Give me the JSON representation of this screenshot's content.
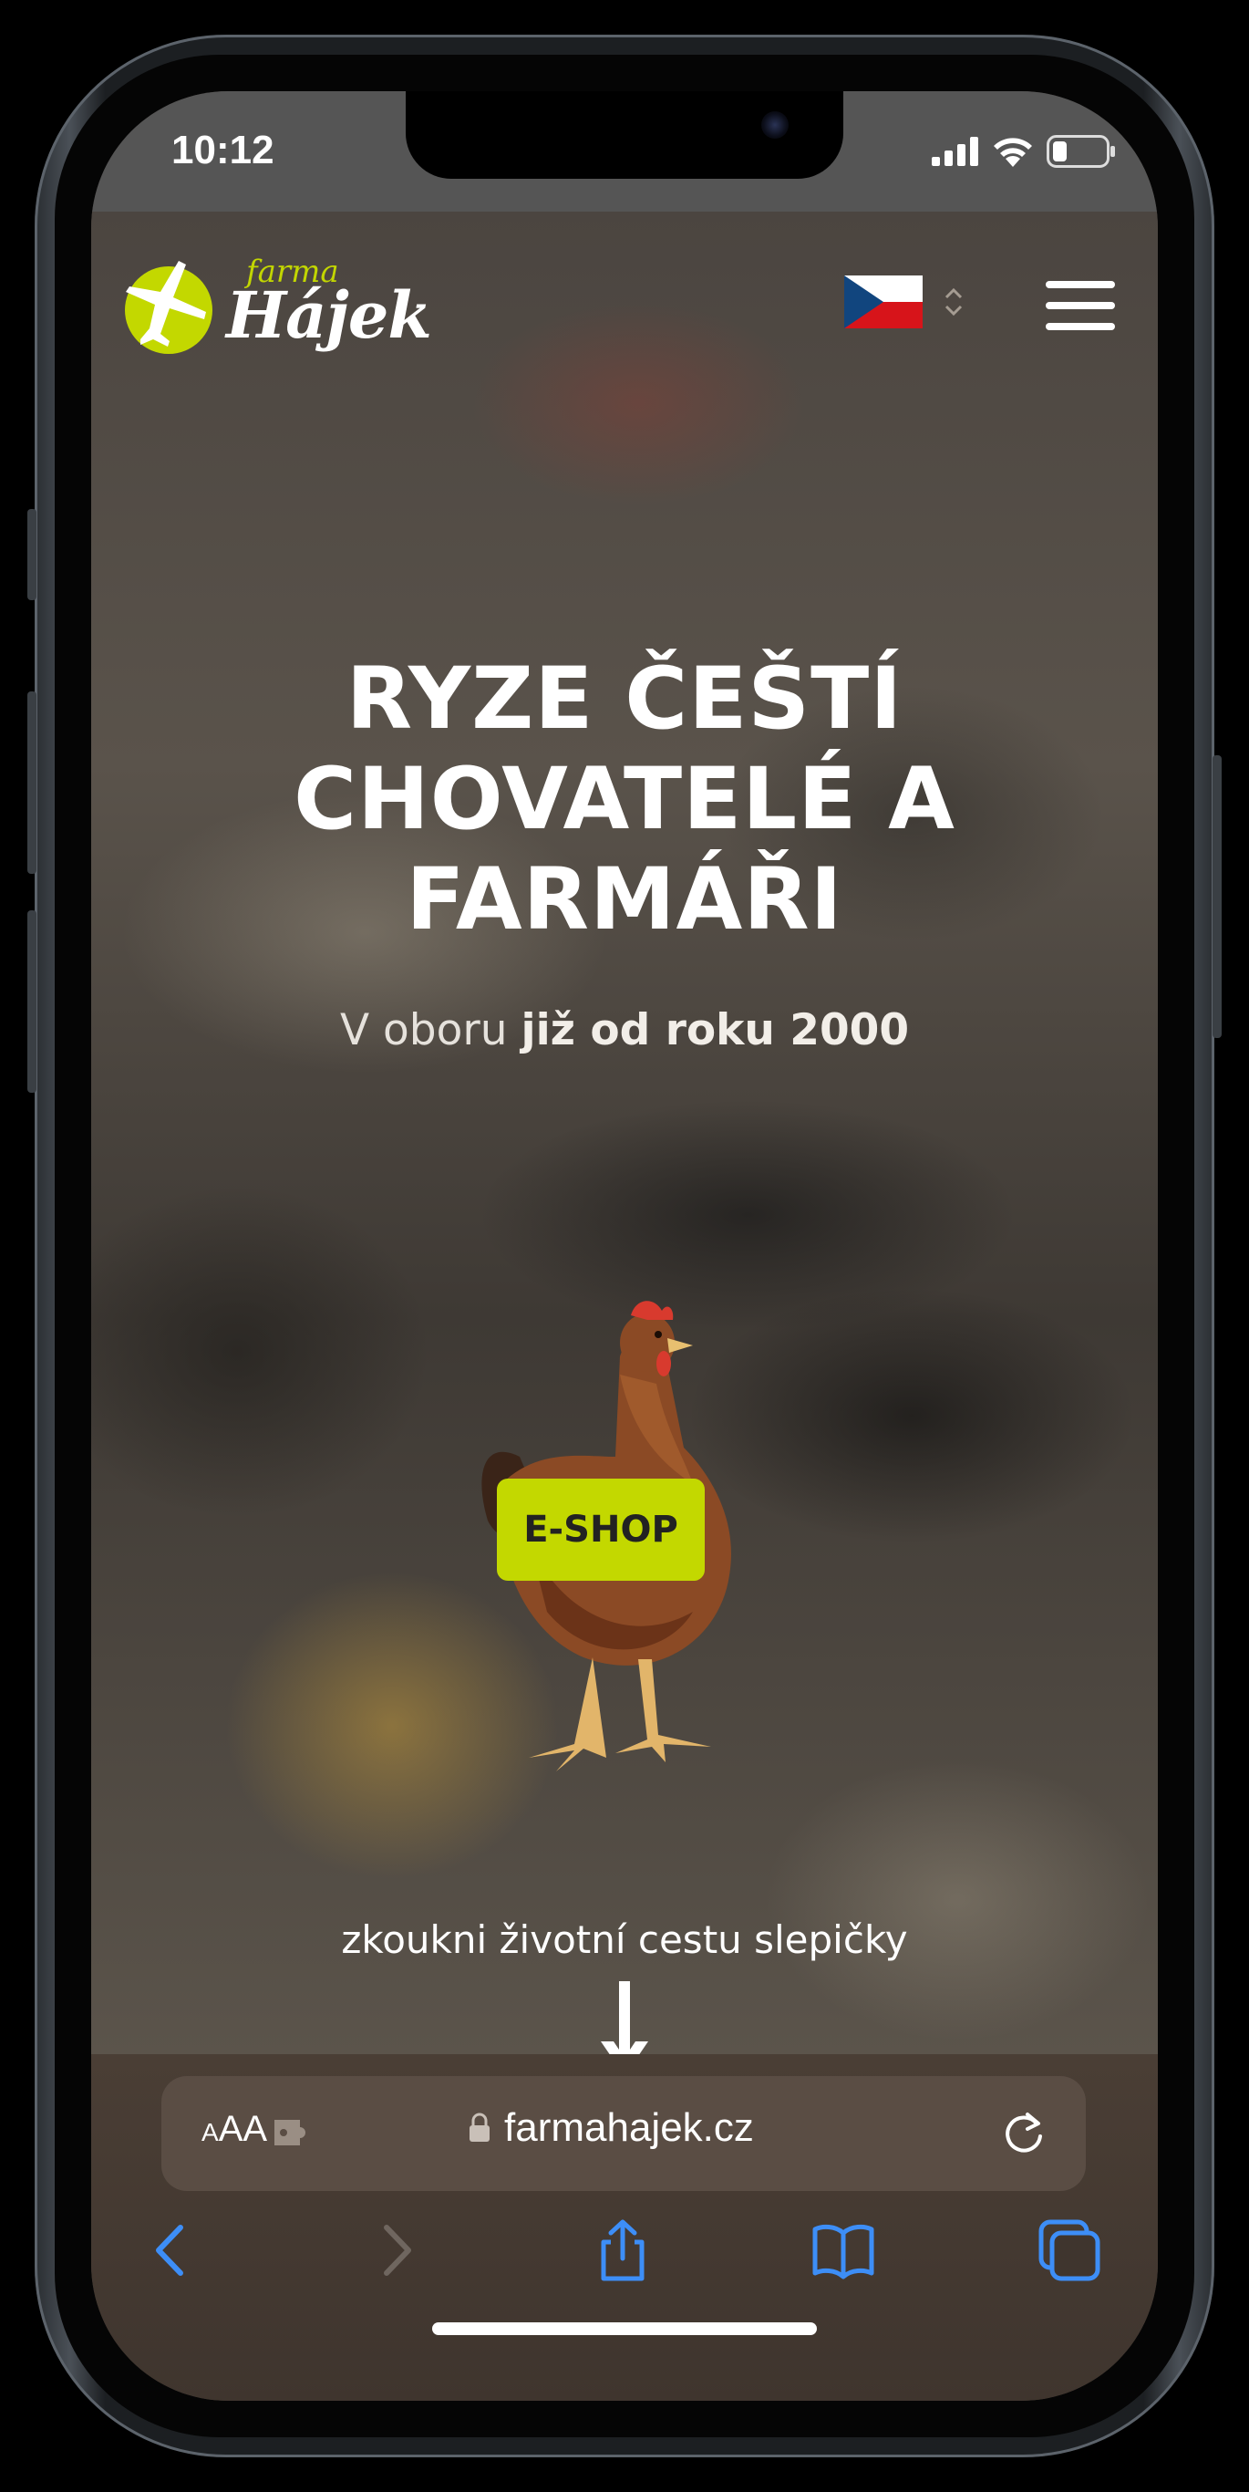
{
  "status_bar": {
    "time": "10:12"
  },
  "header": {
    "logo_small": "farma",
    "logo_name": "Hájek",
    "language_icon": "czech-flag-icon",
    "menu_icon": "hamburger-icon"
  },
  "hero": {
    "headline_lines": [
      "RYZE ČEŠTÍ",
      "CHOVATELÉ A",
      "FARMÁŘI"
    ],
    "subline_prefix": "V oboru ",
    "subline_bold": "již od roku 2000",
    "eshop_label": "E-SHOP",
    "journey_text": "zkoukni životní cestu slepičky"
  },
  "browser": {
    "text_size_label": "AA",
    "url": "farmahajek.cz",
    "icons": [
      "back-icon",
      "forward-icon",
      "share-icon",
      "bookmarks-icon",
      "tabs-icon"
    ]
  },
  "colors": {
    "accent": "#c3d800",
    "text": "#ffffff",
    "ios_blue": "#3d8ef7"
  }
}
